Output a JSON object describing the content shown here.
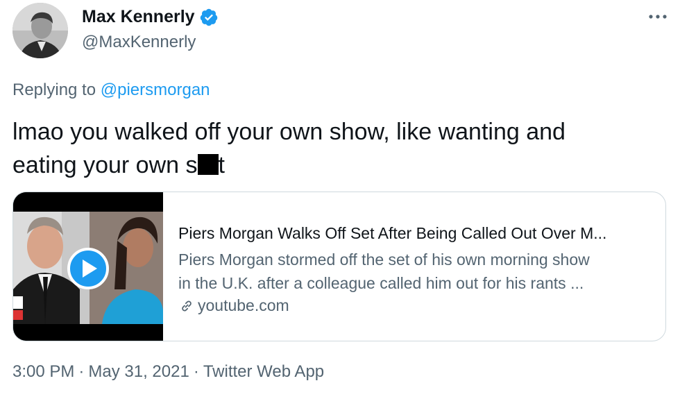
{
  "author": {
    "display_name": "Max Kennerly",
    "handle": "@MaxKennerly",
    "verified_icon": "verified-badge-icon"
  },
  "reply": {
    "prefix": "Replying to",
    "mention": "@piersmorgan"
  },
  "tweet": {
    "line1": "lmao you walked off your own show, like wanting and",
    "line2_before": "eating your own s",
    "line2_after": "t"
  },
  "card": {
    "title": "Piers Morgan Walks Off Set After Being Called Out Over M...",
    "description_line1": "Piers Morgan stormed off the set of his own morning show",
    "description_line2": "in the U.K. after a colleague called him out for his rants ...",
    "domain": "youtube.com",
    "play_icon": "play-icon"
  },
  "meta": {
    "time": "3:00 PM",
    "date": "May 31, 2021",
    "app": "Twitter Web App"
  },
  "colors": {
    "accent": "#1d9bf0",
    "text": "#0f1419",
    "secondary": "#536471",
    "border": "#cfd9de"
  }
}
